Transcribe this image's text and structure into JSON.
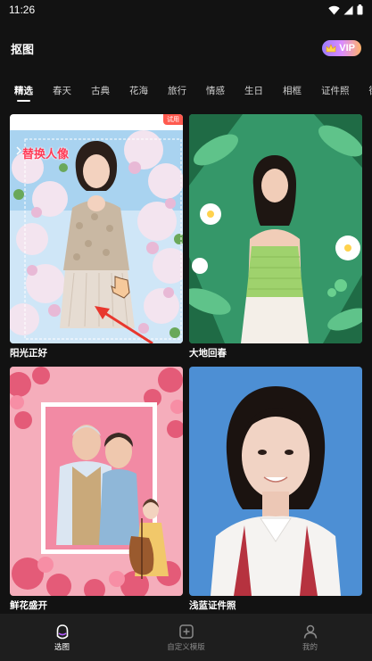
{
  "status": {
    "time": "11:26"
  },
  "header": {
    "title": "抠图",
    "vip_label": "VIP"
  },
  "tabs": [
    {
      "label": "精选",
      "active": true
    },
    {
      "label": "春天"
    },
    {
      "label": "古典"
    },
    {
      "label": "花海"
    },
    {
      "label": "旅行"
    },
    {
      "label": "情感"
    },
    {
      "label": "生日"
    },
    {
      "label": "相框"
    },
    {
      "label": "证件照"
    },
    {
      "label": "街"
    }
  ],
  "templates": [
    {
      "name": "阳光正好",
      "badge": "试用",
      "overlay_text": "替换人像"
    },
    {
      "name": "大地回春"
    },
    {
      "name": "鲜花盛开"
    },
    {
      "name": "浅蓝证件照"
    }
  ],
  "bottom_nav": [
    {
      "label": "选图",
      "icon": "cutout-icon",
      "active": true
    },
    {
      "label": "自定义模版",
      "icon": "add-template-icon"
    },
    {
      "label": "我的",
      "icon": "profile-icon"
    }
  ],
  "colors": {
    "background": "#121212",
    "accent_red": "#ff3b56",
    "trial_badge": "#ff5a4f"
  }
}
